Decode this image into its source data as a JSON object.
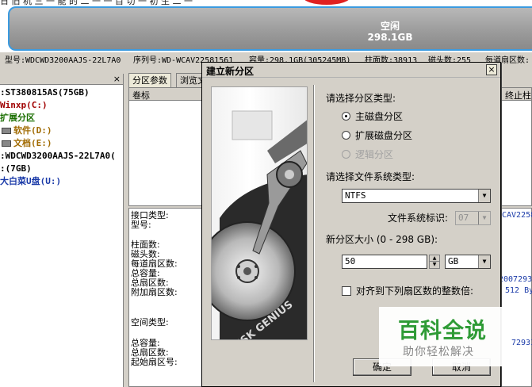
{
  "top": {
    "cut_text": "日 旧 机 三 一 能 的 二 一 一 目 切 一 初 生 二 一",
    "free_label": "空闲",
    "free_size": "298.1GB"
  },
  "info": {
    "model": "型号:WDCWD3200AAJS-22L7A0",
    "serial": "序列号:WD-WCAV22581561",
    "capacity": "容量:298.1GB(305245MB)",
    "cylinders": "柱面数:38913",
    "heads": "磁头数:255",
    "sectors": "每道扇区数:"
  },
  "tree": {
    "close": "×",
    "items": [
      {
        "text": ":ST380815AS(75GB)",
        "color": "#000000"
      },
      {
        "text": "Winxp(C:)",
        "color": "#a00000"
      },
      {
        "text": "扩展分区",
        "color": "#1a6e00"
      },
      {
        "text": "软件(D:)",
        "color": "#a06a00"
      },
      {
        "text": "文档(E:)",
        "color": "#a06a00"
      },
      {
        "text": ":WDCWD3200AAJS-22L7A0(",
        "color": "#000000"
      },
      {
        "text": ":(7GB)",
        "color": "#000000"
      },
      {
        "text": "大白菜U盘(U:)",
        "color": "#1a3aa8"
      }
    ]
  },
  "panel": {
    "tab_params": "分区参数",
    "tab_browse": "浏览文",
    "col_volume": "卷标",
    "col_end": "终止柱",
    "labels": {
      "interface_type": "接口类型:",
      "model": "型号:",
      "cylinders": "柱面数:",
      "heads": "磁头数:",
      "sectors_per_track": "每道扇区数:",
      "total_capacity": "总容量:",
      "total_sectors": "总扇区数:",
      "extra_sectors": "附加扇区数:",
      "space_type": "空间类型:",
      "total_capacity2": "总容量:",
      "total_sectors2": "总扇区数:",
      "start_sector": "起始扇区号:"
    },
    "values": {
      "cav": "CAV2258",
      "num1": "20072933",
      "num2": "512 By",
      "num3": "72933"
    }
  },
  "dialog": {
    "title": "建立新分区",
    "close": "×",
    "image_text": "DISK GENIUS",
    "choose_type_label": "请选择分区类型:",
    "type_primary": "主磁盘分区",
    "type_extended": "扩展磁盘分区",
    "type_logical": "逻辑分区",
    "fs_label": "请选择文件系统类型:",
    "fs_value": "NTFS",
    "fs_id_label": "文件系统标识:",
    "fs_id_value": "07",
    "size_label": "新分区大小 (0 - 298 GB):",
    "size_value": "50",
    "size_unit": "GB",
    "align_label": "对齐到下列扇区数的整数倍:",
    "ok": "确定",
    "cancel": "取消"
  },
  "watermark": {
    "title": "百科全说",
    "subtitle": "助你轻松解决"
  }
}
